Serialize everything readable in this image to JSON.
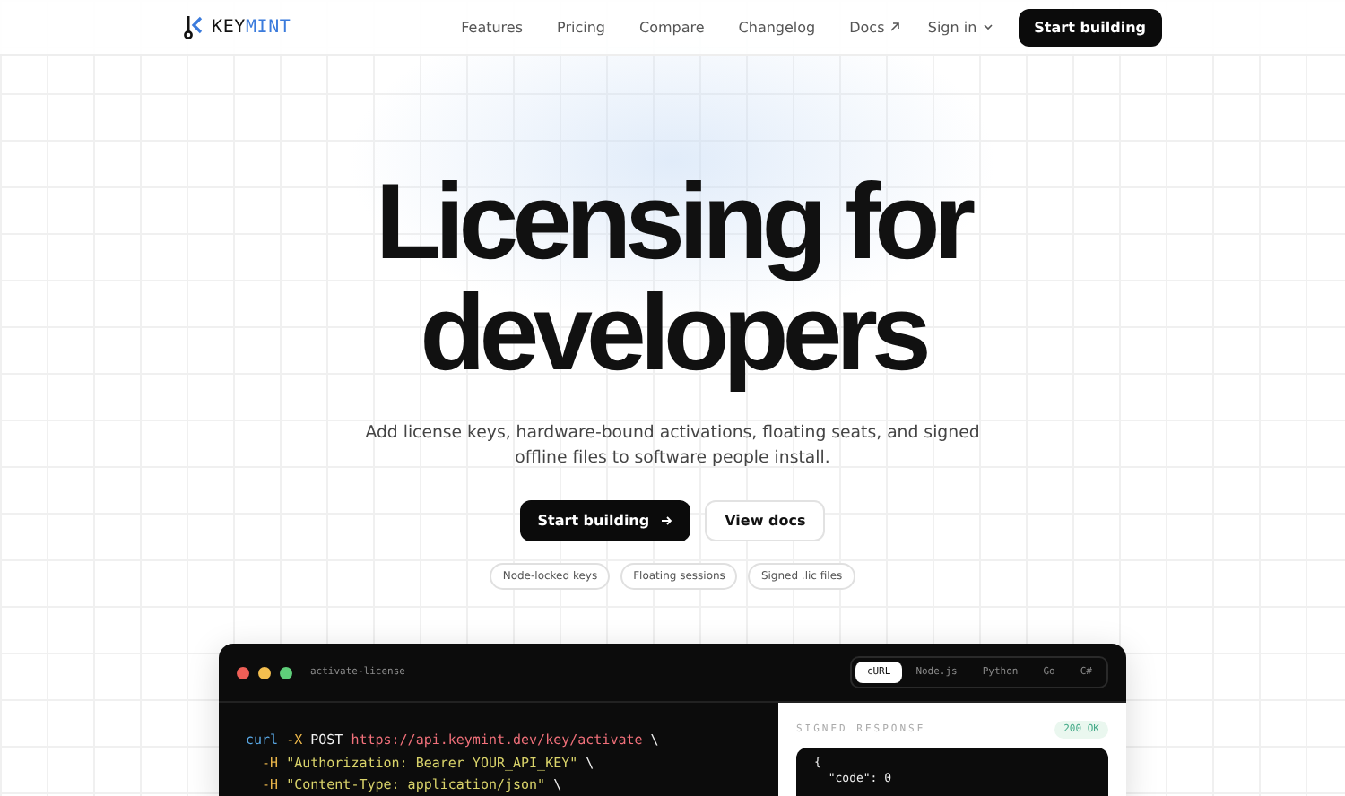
{
  "nav": {
    "brand_prefix": "KEY",
    "brand_suffix": "MINT",
    "links": [
      {
        "label": "Features",
        "external": false
      },
      {
        "label": "Pricing",
        "external": false
      },
      {
        "label": "Compare",
        "external": false
      },
      {
        "label": "Changelog",
        "external": false
      },
      {
        "label": "Docs",
        "external": true
      }
    ],
    "sign_in": "Sign in",
    "cta": "Start building"
  },
  "hero": {
    "title_lines": [
      "Licensing for",
      "developers"
    ],
    "subtitle": "Add license keys, hardware-bound activations, floating seats, and signed offline files to software people install.",
    "primary": "Start building",
    "secondary": "View docs",
    "pills": [
      "Node-locked keys",
      "Floating sessions",
      "Signed .lic files"
    ]
  },
  "code_window": {
    "filename": "activate-license",
    "tabs": [
      {
        "label": "cURL",
        "selected": true
      },
      {
        "label": "Node.js",
        "selected": false
      },
      {
        "label": "Python",
        "selected": false
      },
      {
        "label": "Go",
        "selected": false
      },
      {
        "label": "C#",
        "selected": false
      }
    ],
    "lines": [
      [
        {
          "text": "curl",
          "kind": "cmd"
        },
        {
          "text": " -X",
          "kind": "flag"
        },
        {
          "text": " POST ",
          "kind": "plain"
        },
        {
          "text": "https://api.keymint.dev/key/activate",
          "kind": "url"
        },
        {
          "text": " \\",
          "kind": "plain"
        }
      ],
      [
        {
          "text": "  -H",
          "kind": "flag"
        },
        {
          "text": " \"Authorization: Bearer YOUR_API_KEY\"",
          "kind": "string"
        },
        {
          "text": " \\",
          "kind": "plain"
        }
      ],
      [
        {
          "text": "  -H",
          "kind": "flag"
        },
        {
          "text": " \"Content-Type: application/json\"",
          "kind": "string"
        },
        {
          "text": " \\",
          "kind": "plain"
        }
      ]
    ],
    "response": {
      "label": "SIGNED RESPONSE",
      "status": "200 OK",
      "lines": [
        "{",
        "  \"code\": 0"
      ]
    }
  }
}
